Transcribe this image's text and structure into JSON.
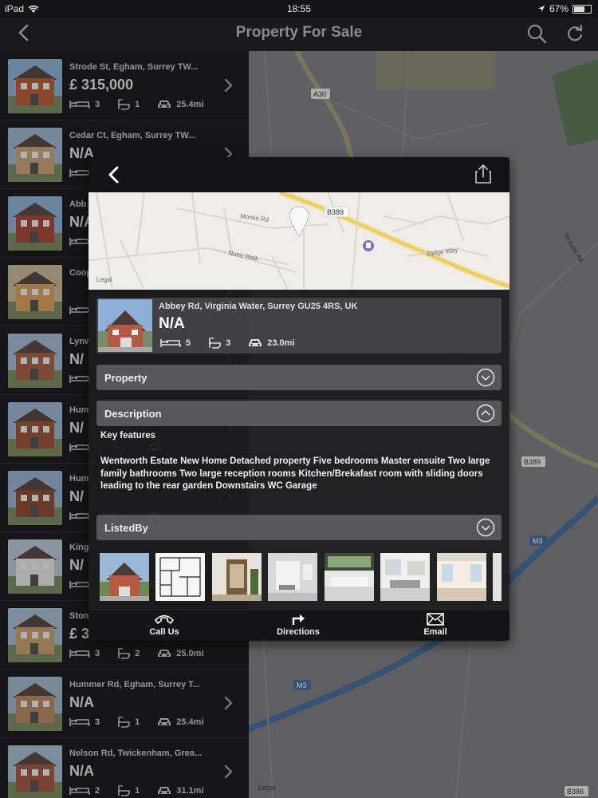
{
  "status": {
    "device": "iPad",
    "time": "18:55",
    "battery": "67%",
    "battery_level": 0.67
  },
  "nav": {
    "title": "Property For Sale"
  },
  "listings": [
    {
      "address": "Strode St, Egham, Surrey TW...",
      "price": "£ 315,000",
      "beds": "3",
      "baths": "1",
      "distance": "25.4mi"
    },
    {
      "address": "Cedar Ct, Egham, Surrey TW...",
      "price": "N/A",
      "beds": "",
      "baths": "",
      "distance": ""
    },
    {
      "address": "Abb",
      "price": "N/A",
      "beds": "",
      "baths": "",
      "distance": ""
    },
    {
      "address": "Coop",
      "price": "",
      "beds": "",
      "baths": "",
      "distance": ""
    },
    {
      "address": "Lynw",
      "price": "N/",
      "beds": "",
      "baths": "",
      "distance": ""
    },
    {
      "address": "Hum",
      "price": "N/",
      "beds": "",
      "baths": "",
      "distance": ""
    },
    {
      "address": "Hum",
      "price": "N/",
      "beds": "",
      "baths": "",
      "distance": ""
    },
    {
      "address": "King",
      "price": "N/",
      "beds": "",
      "baths": "",
      "distance": ""
    },
    {
      "address": "Ston",
      "price": "£ 3",
      "beds": "3",
      "baths": "2",
      "distance": "25.0mi"
    },
    {
      "address": "Hummer Rd, Egham, Surrey T...",
      "price": "N/A",
      "beds": "3",
      "baths": "1",
      "distance": "25.4mi"
    },
    {
      "address": "Nelson Rd, Twickenham, Grea...",
      "price": "N/A",
      "beds": "2",
      "baths": "1",
      "distance": "31.1mi"
    }
  ],
  "bg_map": {
    "labels": [
      "A30",
      "B389",
      "B386",
      "M3",
      "Legal",
      "Stroude Rd"
    ]
  },
  "detail": {
    "map_labels": [
      "Monks Rd",
      "Nuns Walk",
      "B389",
      "Ridge Way",
      "Legal"
    ],
    "address": "Abbey Rd, Virginia Water, Surrey GU25 4RS, UK",
    "price": "N/A",
    "beds": "5",
    "baths": "3",
    "distance": "23.0mi",
    "sections": {
      "property": "Property",
      "description": "Description",
      "listed_by": "ListedBy"
    },
    "key_features_title": "Key features",
    "description_text": "Wentworth Estate New Home Detached property  Five bedrooms Master ensuite Two large family bathrooms Two large reception rooms Kitchen/Brekafast room with sliding doors leading to the rear garden Downstairs WC Garage",
    "actions": {
      "call": "Call Us",
      "directions": "Directions",
      "email": "Email"
    }
  },
  "colors": {
    "panel": "#1c1c1e",
    "section": "#5c5c60",
    "map_bg": "#7a7a7d",
    "road_yellow": "#e8c14a",
    "road_blue": "#4a86d8"
  }
}
